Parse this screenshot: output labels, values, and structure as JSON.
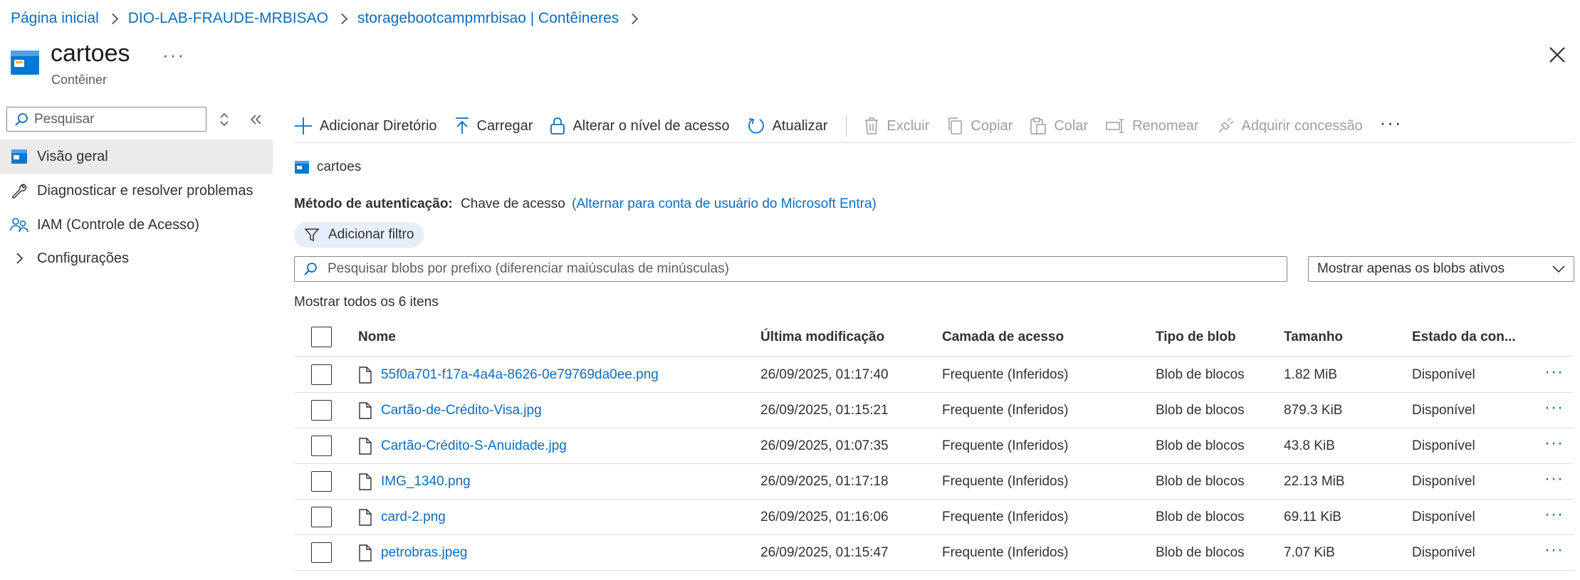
{
  "breadcrumb": [
    "Página inicial",
    "DIO-LAB-FRAUDE-MRBISAO",
    "storagebootcampmrbisao | Contêineres"
  ],
  "header": {
    "title": "cartoes",
    "subtitle": "Contêiner",
    "more": "···"
  },
  "sidebar": {
    "search_placeholder": "Pesquisar",
    "items": [
      {
        "label": "Visão geral",
        "icon": "container-icon",
        "active": true
      },
      {
        "label": "Diagnosticar e resolver problemas",
        "icon": "wrench-icon",
        "active": false
      },
      {
        "label": "IAM (Controle de Acesso)",
        "icon": "people-icon",
        "active": false
      },
      {
        "label": "Configurações",
        "icon": "chevron-right-icon",
        "active": false
      }
    ]
  },
  "toolbar": {
    "add_directory": "Adicionar Diretório",
    "upload": "Carregar",
    "change_access": "Alterar o nível de acesso",
    "refresh": "Atualizar",
    "delete": "Excluir",
    "copy": "Copiar",
    "paste": "Colar",
    "rename": "Renomear",
    "acquire_lease": "Adquirir concessão",
    "more": "···"
  },
  "container_crumb": "cartoes",
  "auth": {
    "label": "Método de autenticação:",
    "value": "Chave de acesso",
    "switch_link": "(Alternar para conta de usuário do Microsoft Entra)"
  },
  "add_filter": "Adicionar filtro",
  "blob_search_placeholder": "Pesquisar blobs por prefixo (diferenciar maiúsculas de minúsculas)",
  "blob_filter_select": "Mostrar apenas os blobs ativos",
  "item_count": "Mostrar todos os 6 itens",
  "table": {
    "headers": {
      "name": "Nome",
      "modified": "Última modificação",
      "tier": "Camada de acesso",
      "blob_type": "Tipo de blob",
      "size": "Tamanho",
      "state": "Estado da con..."
    },
    "rows": [
      {
        "name": "55f0a701-f17a-4a4a-8626-0e79769da0ee.png",
        "modified": "26/09/2025, 01:17:40",
        "tier": "Frequente (Inferidos)",
        "blob_type": "Blob de blocos",
        "size": "1.82 MiB",
        "state": "Disponível"
      },
      {
        "name": "Cartão-de-Crédito-Visa.jpg",
        "modified": "26/09/2025, 01:15:21",
        "tier": "Frequente (Inferidos)",
        "blob_type": "Blob de blocos",
        "size": "879.3 KiB",
        "state": "Disponível"
      },
      {
        "name": "Cartão-Crédito-S-Anuidade.jpg",
        "modified": "26/09/2025, 01:07:35",
        "tier": "Frequente (Inferidos)",
        "blob_type": "Blob de blocos",
        "size": "43.8 KiB",
        "state": "Disponível"
      },
      {
        "name": "IMG_1340.png",
        "modified": "26/09/2025, 01:17:18",
        "tier": "Frequente (Inferidos)",
        "blob_type": "Blob de blocos",
        "size": "22.13 MiB",
        "state": "Disponível"
      },
      {
        "name": "card-2.png",
        "modified": "26/09/2025, 01:16:06",
        "tier": "Frequente (Inferidos)",
        "blob_type": "Blob de blocos",
        "size": "69.11 KiB",
        "state": "Disponível"
      },
      {
        "name": "petrobras.jpeg",
        "modified": "26/09/2025, 01:15:47",
        "tier": "Frequente (Inferidos)",
        "blob_type": "Blob de blocos",
        "size": "7.07 KiB",
        "state": "Disponível"
      }
    ],
    "row_more": "···"
  },
  "colors": {
    "accent": "#0f6cbd",
    "nav_active_bg": "#edebe9",
    "filter_pill_bg": "#e6eefa",
    "container_icon": "#0078d4"
  }
}
